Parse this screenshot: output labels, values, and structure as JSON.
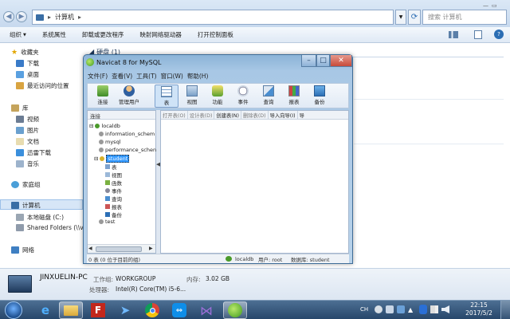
{
  "explorer": {
    "path_icon": "computer-icon",
    "address": "计算机",
    "search_placeholder": "搜索 计算机",
    "commands": [
      "组织",
      "系统属性",
      "卸载或更改程序",
      "映射网络驱动器",
      "打开控制面板"
    ],
    "section_label": "硬盘 (1)",
    "nav": {
      "favorites": "收藏夹",
      "favorite_items": [
        "下载",
        "桌面",
        "最近访问的位置"
      ],
      "libraries": "库",
      "library_items": [
        "视频",
        "图片",
        "文档",
        "迅雷下载",
        "音乐"
      ],
      "homegroup": "家庭组",
      "computer": "计算机",
      "computer_items": [
        "本地磁盘 (C:)",
        "Shared Folders (\\\\vr"
      ],
      "network": "网络"
    },
    "details": {
      "name": "JINXUELIN-PC",
      "workgroup_label": "工作组:",
      "workgroup": "WORKGROUP",
      "memory_label": "内存:",
      "memory": "3.02 GB",
      "cpu_label": "处理器:",
      "cpu": "Intel(R) Core(TM) i5-6..."
    }
  },
  "navicat": {
    "title": "Navicat 8 for MySQL",
    "menu": [
      "文件(F)",
      "查看(V)",
      "工具(T)",
      "窗口(W)",
      "帮助(H)"
    ],
    "toolbar": [
      "连接",
      "管理用户",
      "表",
      "视图",
      "功能",
      "事件",
      "查询",
      "报表",
      "备份"
    ],
    "left_header": "连接",
    "connection": "localdb",
    "databases": [
      "information_schem",
      "mysql",
      "performance_schen",
      "student",
      "test"
    ],
    "selected_db": "student",
    "db_children": [
      "表",
      "视图",
      "函数",
      "事件",
      "查询",
      "报表",
      "备份"
    ],
    "right_toolbar": [
      "打开表(O)",
      "设计表(D)",
      "创建表(N)",
      "删除表(D)",
      "导入向导(I)",
      "导"
    ],
    "status": {
      "left": "0 表 (0 位于目前的组)",
      "conn": "localdb",
      "user": "用户: root",
      "db": "数据库: student"
    }
  },
  "taskbar": {
    "lang": "CH",
    "time": "22:15",
    "date": "2017/5/2"
  },
  "colors": {
    "titlebar": "#a8c7e5",
    "close": "#c74a3a",
    "taskbar": "#27476b",
    "selection": "#3399ff"
  }
}
